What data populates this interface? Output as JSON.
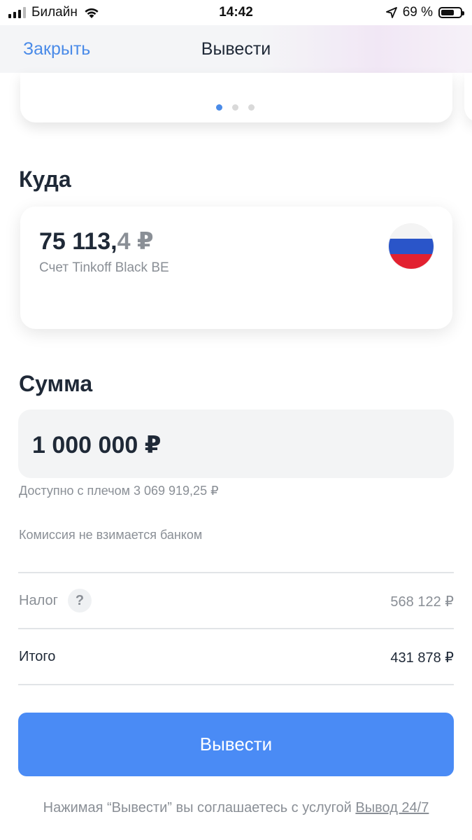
{
  "status_bar": {
    "carrier": "Билайн",
    "time": "14:42",
    "battery_percent": "69 %",
    "signal_icon": "cellular-signal-icon",
    "wifi_icon": "wifi-icon",
    "location_icon": "location-arrow-icon",
    "battery_icon": "battery-icon",
    "battery_level": 0.69
  },
  "nav": {
    "close_label": "Закрыть",
    "title": "Вывести"
  },
  "carousel": {
    "page_count": 3,
    "active_index": 0
  },
  "destination": {
    "heading": "Куда",
    "balance_int": "75 113,",
    "balance_frac": "4 ₽",
    "account_name": "Счет Tinkoff Black BE",
    "flag_icon": "russia-flag-icon"
  },
  "amount": {
    "heading": "Сумма",
    "value": "1 000 000 ₽",
    "available_hint": "Доступно с плечом 3 069 919,25 ₽",
    "commission_hint": "Комиссия не взимается банком"
  },
  "summary": {
    "tax_label": "Налог",
    "tax_help": "?",
    "tax_value": "568 122 ₽",
    "total_label": "Итого",
    "total_value": "431 878 ₽"
  },
  "action": {
    "button_label": "Вывести",
    "consent_prefix": "Нажимая “Вывести” вы соглашаетесь с услугой ",
    "consent_link": "Вывод 24/7"
  },
  "colors": {
    "accent": "#4a8bf5",
    "link": "#4a8be8",
    "text": "#1f2937",
    "muted": "#8a8f96"
  }
}
